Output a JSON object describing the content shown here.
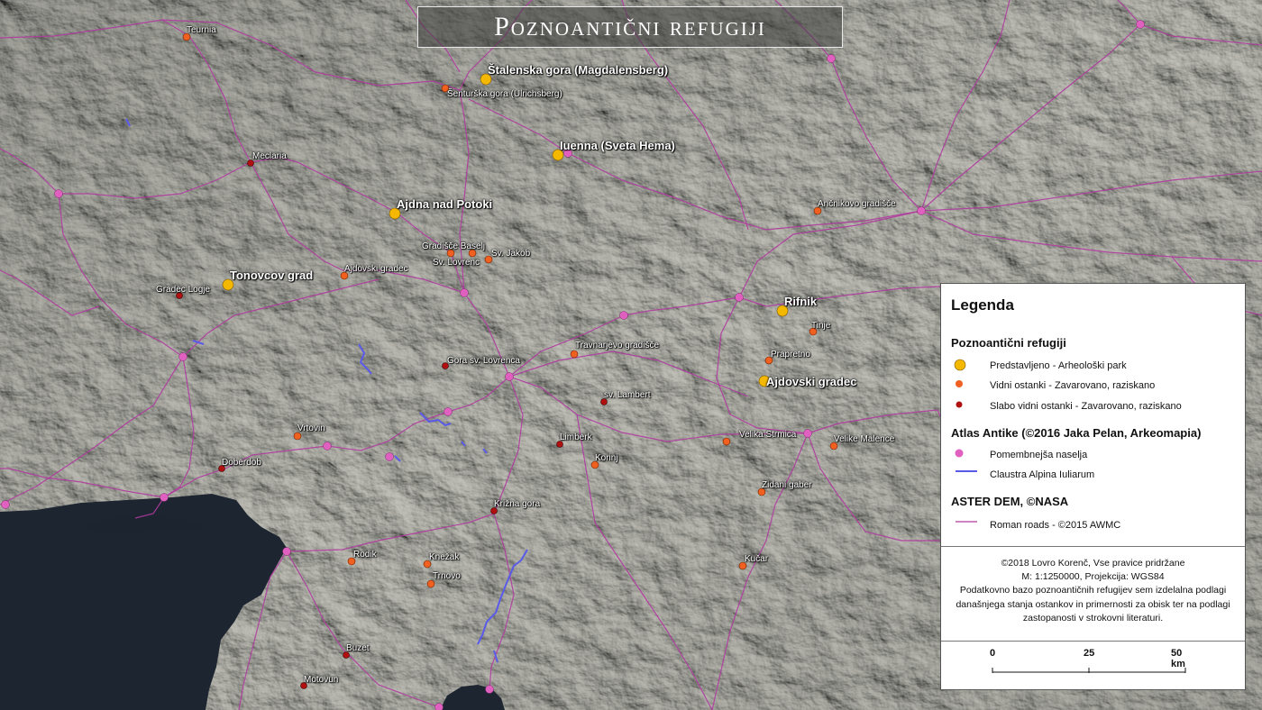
{
  "title": "Poznoantični refugiji",
  "colors": {
    "presented": "#f5b800",
    "visible": "#f06020",
    "faint": "#b01010",
    "settlement": "#e060c0",
    "claustra": "#5a5ae8",
    "roads": "#b03a9e",
    "sea": "#1c2530"
  },
  "sites": {
    "presented": [
      {
        "name": "Štalenska gora (Magdalensberg)"
      },
      {
        "name": "Iuenna (Sveta Hema)"
      },
      {
        "name": "Ajdna nad Potoki"
      },
      {
        "name": "Tonovcov grad"
      },
      {
        "name": "Rifnik"
      },
      {
        "name": "Ajdovski gradec"
      }
    ],
    "visible": [
      {
        "name": "Šenturška gora (Ulrichsberg)"
      },
      {
        "name": "Ančnikovo gradišče"
      },
      {
        "name": "Gradišče Baselj"
      },
      {
        "name": "Sv. Jakob"
      },
      {
        "name": "Sv. Lovrenc"
      },
      {
        "name": "Ajdovski gradec"
      },
      {
        "name": "Tinje"
      },
      {
        "name": "Prapretno"
      },
      {
        "name": "Travnarjevo gradišče"
      },
      {
        "name": "Vrtovin"
      },
      {
        "name": "Korinj"
      },
      {
        "name": "Velika Strmica"
      },
      {
        "name": "Velike Malence"
      },
      {
        "name": "Zidani gaber"
      },
      {
        "name": "Rodik"
      },
      {
        "name": "Knežak"
      },
      {
        "name": "Trnovo"
      },
      {
        "name": "Kučar"
      },
      {
        "name": "Teurnia"
      }
    ],
    "faint": [
      {
        "name": "Meclaria"
      },
      {
        "name": "Gradec Logje"
      },
      {
        "name": "Gora sv. Lovrenca"
      },
      {
        "name": "sv. Lambert"
      },
      {
        "name": "Limberk"
      },
      {
        "name": "Doberdob"
      },
      {
        "name": "Križna gora"
      },
      {
        "name": "Buzet"
      },
      {
        "name": "Motovun"
      }
    ]
  },
  "legend": {
    "title": "Legenda",
    "section1": "Poznoantični refugiji",
    "item_presented": "Predstavljeno - Arheološki park",
    "item_visible": "Vidni ostanki - Zavarovano, raziskano",
    "item_faint": "Slabo vidni ostanki - Zavarovano, raziskano",
    "section2": "Atlas Antike (©2016 Jaka Pelan, Arkeomapia)",
    "item_settlement": "Pomembnejša naselja",
    "item_claustra": "Claustra Alpina Iuliarum",
    "section3": "ASTER DEM, ©NASA",
    "item_roads": "Roman roads - ©2015 AWMC",
    "credits": [
      "©2018 Lovro Korenč, Vse pravice pridržane",
      "M: 1:1250000, Projekcija: WGS84",
      "Podatkovno bazo poznoantičnih refugijev sem izdelalna podlagi",
      "današnjega stanja ostankov in primernosti za obisk ter na podlagi",
      "zastopanosti v strokovni literaturi."
    ],
    "scale": {
      "ticks": [
        "0",
        "25",
        "50 km"
      ]
    }
  }
}
